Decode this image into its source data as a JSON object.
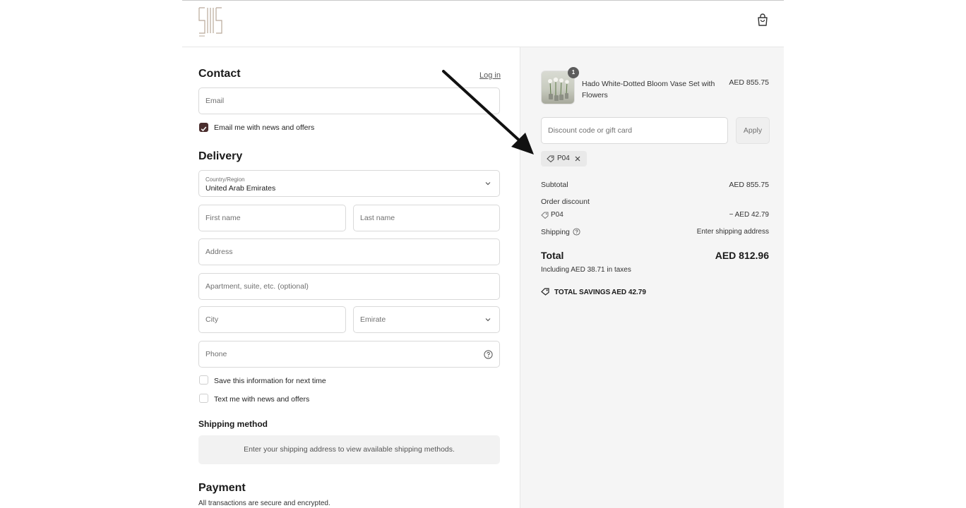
{
  "header": {
    "logo": "logo-icon",
    "cart": "bag-icon"
  },
  "contact": {
    "title": "Contact",
    "login_link": "Log in",
    "email_placeholder": "Email",
    "news_checkbox_label": "Email me with news and offers",
    "news_checked": true
  },
  "delivery": {
    "title": "Delivery",
    "country_label": "Country/Region",
    "country_value": "United Arab Emirates",
    "first_name": "First name",
    "last_name": "Last name",
    "address": "Address",
    "apartment": "Apartment, suite, etc. (optional)",
    "city": "City",
    "emirate": "Emirate",
    "phone": "Phone",
    "save_info": "Save this information for next time",
    "text_offers": "Text me with news and offers"
  },
  "shipping_method": {
    "title": "Shipping method",
    "message": "Enter your shipping address to view available shipping methods."
  },
  "payment": {
    "title": "Payment",
    "subtitle": "All transactions are secure and encrypted."
  },
  "summary": {
    "item": {
      "name": "Hado White-Dotted Bloom Vase Set with Flowers",
      "quantity": "1",
      "price": "AED 855.75"
    },
    "discount_placeholder": "Discount code or gift card",
    "apply_label": "Apply",
    "applied_code": "P04",
    "subtotal_label": "Subtotal",
    "subtotal_value": "AED 855.75",
    "order_discount_label": "Order discount",
    "discount_code": "P04",
    "discount_value": "− AED 42.79",
    "shipping_label": "Shipping",
    "shipping_value": "Enter shipping address",
    "total_label": "Total",
    "total_value": "AED 812.96",
    "taxes_note": "Including AED 38.71 in taxes",
    "savings_label": "TOTAL SAVINGS",
    "savings_value": "AED 42.79"
  },
  "colors": {
    "accent": "#4a2e2e",
    "summary_bg": "#f5f5f5"
  }
}
